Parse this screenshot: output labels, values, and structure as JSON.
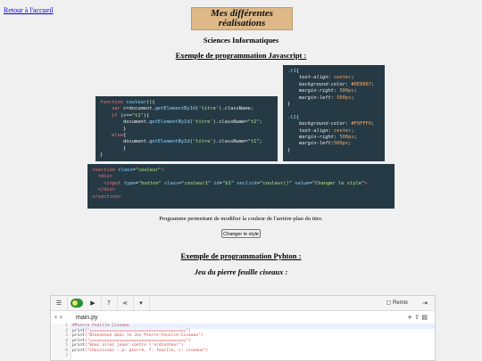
{
  "nav": {
    "back_label": "Retour à l'accueil"
  },
  "header": {
    "title_line1": "Mes différentes",
    "title_line2": "réalisations"
  },
  "subtitle": "Sciences Informatiques",
  "js_section": {
    "heading": "Exemple de programmation Javascript :",
    "description": "Programme permettant de modifier la couleur de l'arrière-plan du titre.",
    "button_label": "Changer le style"
  },
  "py_section": {
    "heading": "Exemple de programmation Pyhton :",
    "game_title": "Jeu du pierre feuille ciseaux :"
  },
  "editor": {
    "remix_label": "Remix",
    "file_name": "main.py",
    "line_numbers": [
      "1",
      "2",
      "3",
      "4",
      "5",
      "6",
      "7"
    ],
    "lines": [
      "#Pierre Feuille Ciseaux",
      "",
      "print(\"=======================================\")",
      "print(\"Bienvenue dans le Jeu Pierre-Feuille-Ciseaux\")",
      "print(\"=======================================\")",
      "print(\"Vous allez jouer contre l'ordinateur\")",
      "print(\"Choisissez : p: pierre, f: feuille, c: ciseaux\")"
    ]
  },
  "colors": {
    "title_bg": "#deb887",
    "code_bg": "#263a45",
    "alt_bg": "#f0fff0"
  }
}
